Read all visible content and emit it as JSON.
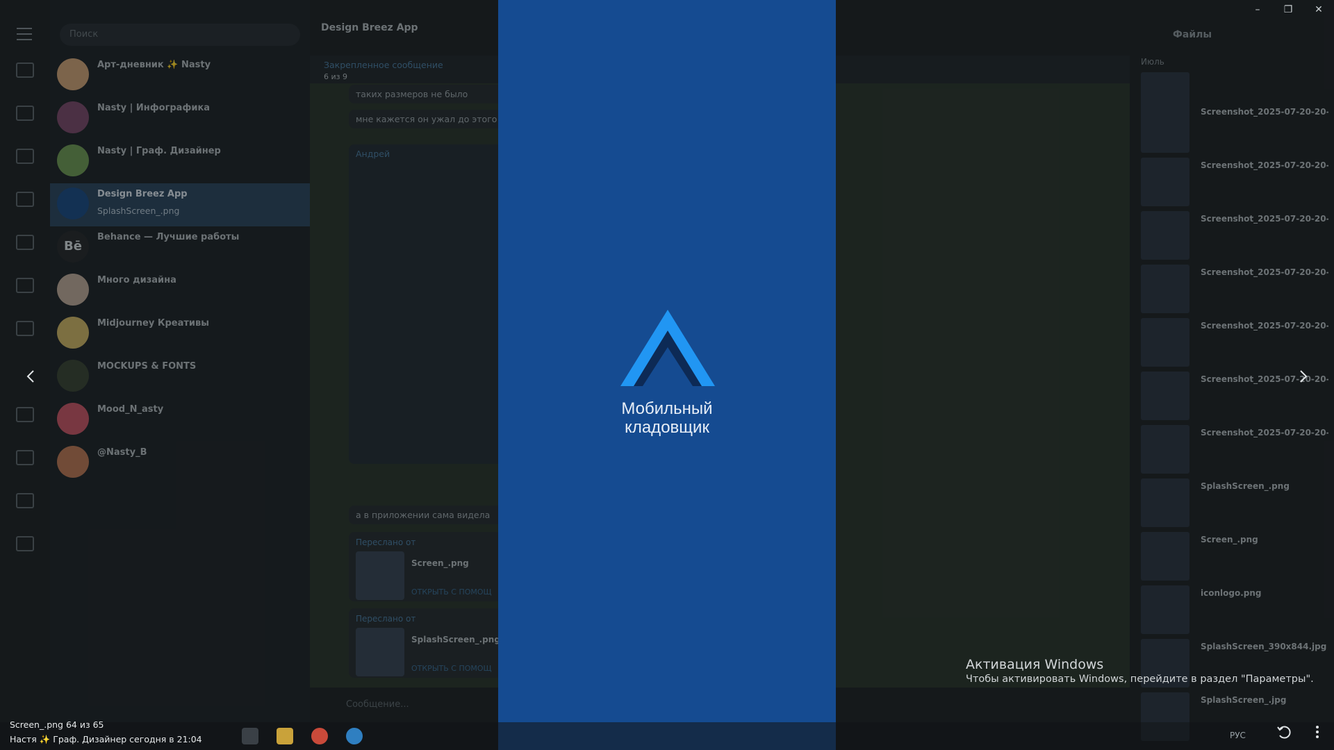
{
  "window": {
    "controls": {
      "minimize": "–",
      "maximize": "❐",
      "close": "✕"
    }
  },
  "sidebar": {
    "folders": [
      {
        "label": "",
        "badge": ""
      },
      {
        "label": "",
        "badge": ""
      },
      {
        "label": "",
        "badge": ""
      },
      {
        "label": "",
        "badge": ""
      },
      {
        "label": "",
        "badge": ""
      },
      {
        "label": "",
        "badge": ""
      },
      {
        "label": "",
        "badge": ""
      },
      {
        "label": "",
        "badge": ""
      },
      {
        "label": "",
        "badge": ""
      },
      {
        "label": "",
        "badge": ""
      },
      {
        "label": "",
        "badge": ""
      }
    ]
  },
  "chatlist": {
    "search_placeholder": "Поиск",
    "chats": [
      {
        "name": "Арт-дневник ✨ Nasty",
        "time": "",
        "preview": "",
        "badge": "",
        "avatar": ""
      },
      {
        "name": "Nasty | Инфографика",
        "time": "",
        "preview": "",
        "badge": "",
        "avatar": ""
      },
      {
        "name": "Nasty | Граф. Дизайнер",
        "time": "",
        "preview": "",
        "badge": "",
        "avatar": ""
      },
      {
        "name": "Design Breez App",
        "time": "",
        "preview": "SplashScreen_.png",
        "badge": "",
        "avatar": ""
      },
      {
        "name": "Behance — Лучшие работы",
        "time": "",
        "preview": "",
        "badge": "",
        "avatar": "Bē"
      },
      {
        "name": "Много дизайна",
        "time": "",
        "preview": "",
        "badge": "",
        "avatar": ""
      },
      {
        "name": "Midjourney Креативы",
        "time": "",
        "preview": "",
        "badge": "",
        "avatar": ""
      },
      {
        "name": "MOCKUPS & FONTS",
        "time": "",
        "preview": "",
        "badge": "",
        "avatar": ""
      },
      {
        "name": "Mood_N_asty",
        "time": "",
        "preview": "",
        "badge": "",
        "avatar": ""
      },
      {
        "name": "@Nasty_B",
        "time": "",
        "preview": "",
        "badge": "",
        "avatar": ""
      }
    ]
  },
  "chat": {
    "title": "Design Breez App",
    "subtitle": "",
    "pinned_title": "Закрепленное сообщение",
    "pinned_count": "6 из 9",
    "messages": [
      "таких размеров не было",
      "мне кажется он ужал до этого пе",
      "а в приложении сама видела"
    ],
    "sender": "Андрей",
    "forwarded": [
      {
        "header": "Переслано от",
        "filename": "Screen_.png",
        "open": "ОТКРЫТЬ С ПОМОЩ"
      },
      {
        "header": "Переслано от",
        "filename": "SplashScreen_.png",
        "open": "ОТКРЫТЬ С ПОМОЩ"
      }
    ],
    "input_placeholder": "Сообщение..."
  },
  "files": {
    "title": "Файлы",
    "month": "Июль",
    "items": [
      {
        "name": ""
      },
      {
        "name": "Screenshot_2025-07-20-20-..."
      },
      {
        "name": "Screenshot_2025-07-20-20-..."
      },
      {
        "name": "Screenshot_2025-07-20-20-..."
      },
      {
        "name": "Screenshot_2025-07-20-20-..."
      },
      {
        "name": "Screenshot_2025-07-20-20-..."
      },
      {
        "name": "Screenshot_2025-07-20-20-..."
      },
      {
        "name": "Screenshot_2025-07-20-20-..."
      },
      {
        "name": "SplashScreen_.png"
      },
      {
        "name": "Screen_.png"
      },
      {
        "name": "iconlogo.png"
      },
      {
        "name": "SplashScreen_390x844.jpg"
      },
      {
        "name": "SplashScreen_.jpg"
      }
    ]
  },
  "viewer": {
    "app_title_line1": "Мобильный",
    "app_title_line2": "кладовщик",
    "logo_colors": {
      "light": "#2196f3",
      "dark": "#0d2a55"
    },
    "background": "#154b91",
    "file_counter": "Screen_.png 64 из 65",
    "author_line": "Настя ✨ Граф. Дизайнер    сегодня в 21:04"
  },
  "watermark": {
    "title": "Активация Windows",
    "subtitle": "Чтобы активировать Windows, перейдите в раздел \"Параметры\"."
  },
  "taskbar": {
    "lang": "РУС"
  }
}
